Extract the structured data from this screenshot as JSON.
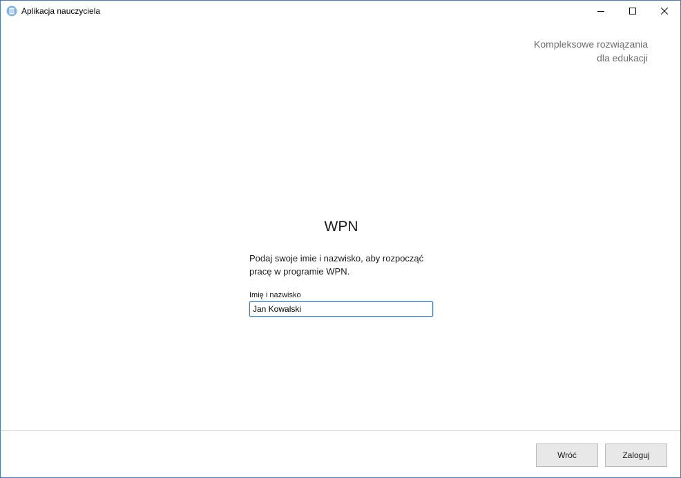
{
  "window": {
    "title": "Aplikacja nauczyciela",
    "icon": "app-book-icon",
    "controls": [
      "minimize-icon",
      "maximize-icon",
      "close-icon"
    ]
  },
  "header": {
    "tagline_line1": "Kompleksowe rozwiązania",
    "tagline_line2": "dla edukacji"
  },
  "main": {
    "app_name": "WPN",
    "instruction_line1": "Podaj swoje imie i nazwisko, aby rozpocząć",
    "instruction_line2": "pracę w programie WPN.",
    "name_field": {
      "label": "Imię i nazwisko",
      "value": "Jan Kowalski"
    }
  },
  "footer": {
    "back_label": "Wróć",
    "login_label": "Zaloguj"
  },
  "colors": {
    "accent": "#3c7fb1",
    "window_border": "#4a7ab5",
    "tagline": "#6d6d6d",
    "button_bg": "#e8e8e8"
  }
}
